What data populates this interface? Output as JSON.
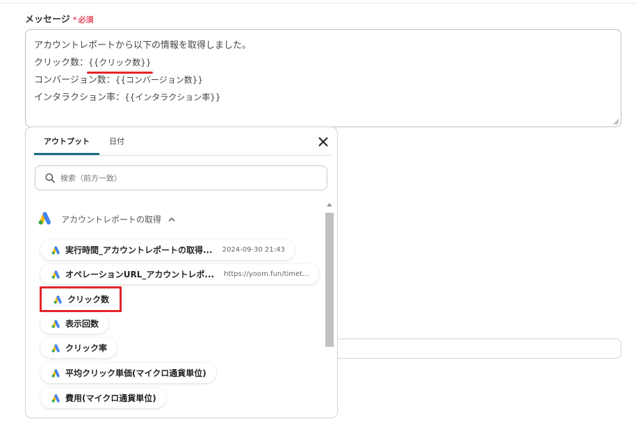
{
  "form": {
    "label": "メッセージ",
    "required_mark": "*",
    "required_text": "必須",
    "message_lines": [
      {
        "text": "アカウントレポートから以下の情報を取得しました。"
      },
      {
        "prefix": "クリック数：",
        "token": "{{クリック数}}"
      },
      {
        "prefix": "コンバージョン数：",
        "token": "{{コンバージョン数}}"
      },
      {
        "prefix": "インタラクション率：",
        "token": "{{インタラクション率}}"
      }
    ]
  },
  "panel": {
    "tabs": [
      "アウトプット",
      "日付"
    ],
    "active_tab": "アウトプット",
    "close_icon": "close-icon",
    "search_placeholder": "検索（前方一致）",
    "section_title": "アカウントレポートの取得",
    "section_icon": "google-ads-icon",
    "items": [
      {
        "label": "実行時間_アカウントレポートの取得...",
        "value": "2024-09-30 21:43"
      },
      {
        "label": "オペレーションURL_アカウントレポ...",
        "value": "https://yoom.fun/timet..."
      },
      {
        "label": "クリック数",
        "value": "",
        "highlighted": true
      },
      {
        "label": "表示回数",
        "value": ""
      },
      {
        "label": "クリック率",
        "value": ""
      },
      {
        "label": "平均クリック単価(マイクロ通貨単位)",
        "value": ""
      },
      {
        "label": "費用(マイクロ通貨単位)",
        "value": ""
      }
    ]
  },
  "colors": {
    "accent": "#1c6b84",
    "required": "#e84b5f",
    "highlight": "#e3242b",
    "ads_blue": "#4285f4",
    "ads_yellow": "#fbbc04",
    "ads_green": "#34a853"
  }
}
